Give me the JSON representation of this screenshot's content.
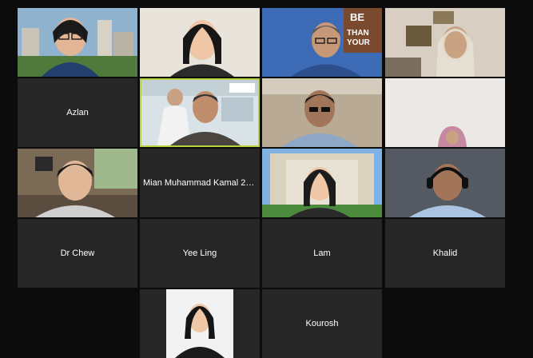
{
  "meeting": {
    "participants": [
      {
        "id": "p1",
        "name": "",
        "video": true
      },
      {
        "id": "p2",
        "name": "",
        "video": true
      },
      {
        "id": "p3",
        "name": "",
        "video": true,
        "poster_text": "BE THAN YOUR"
      },
      {
        "id": "p4",
        "name": "",
        "video": true
      },
      {
        "id": "p5",
        "name": "Azlan",
        "video": false
      },
      {
        "id": "p6",
        "name": "",
        "video": true,
        "active_speaker": true
      },
      {
        "id": "p7",
        "name": "",
        "video": true
      },
      {
        "id": "p8",
        "name": "",
        "video": true
      },
      {
        "id": "p9",
        "name": "",
        "video": true
      },
      {
        "id": "p10",
        "name": "Mian Muhammad Kamal 21...",
        "video": false
      },
      {
        "id": "p11",
        "name": "",
        "video": true
      },
      {
        "id": "p12",
        "name": "",
        "video": true
      },
      {
        "id": "p13",
        "name": "Dr Chew",
        "video": false
      },
      {
        "id": "p14",
        "name": "Yee Ling",
        "video": false
      },
      {
        "id": "p15",
        "name": "Lam",
        "video": false
      },
      {
        "id": "p16",
        "name": "Khalid",
        "video": false
      },
      {
        "id": "p17",
        "name": "",
        "video": true
      },
      {
        "id": "p18",
        "name": "Kourosh",
        "video": false
      }
    ],
    "colors": {
      "background": "#0c0c0c",
      "tile": "#262626",
      "active_speaker_border": "#b7d23a"
    }
  }
}
